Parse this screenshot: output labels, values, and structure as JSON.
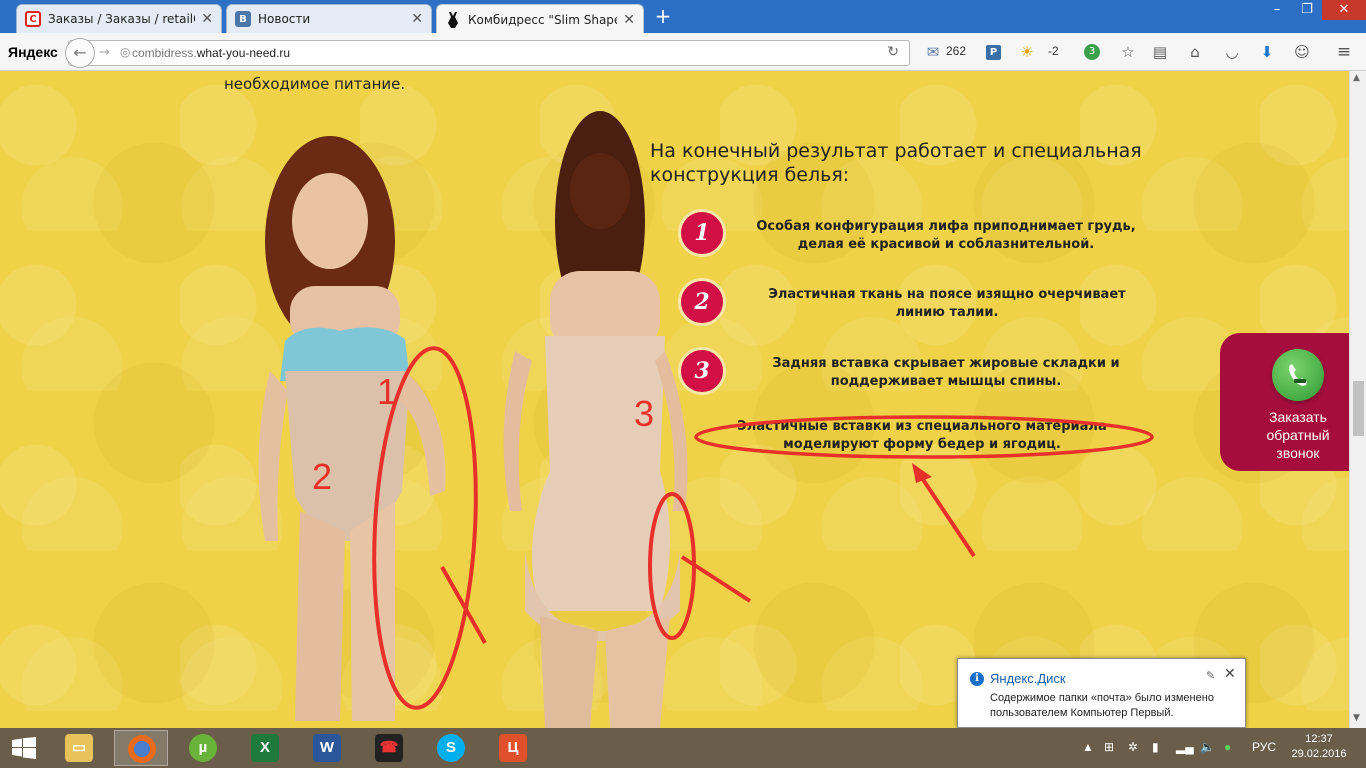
{
  "browser": {
    "tabs": [
      {
        "label": "Заказы / Заказы / retailC",
        "favicon": "retailcrm-icon",
        "active": false
      },
      {
        "label": "Новости",
        "favicon": "vk-icon",
        "active": false
      },
      {
        "label": "Комбидресс \"Slim Shape",
        "favicon": "bodysuit-icon",
        "active": true
      }
    ],
    "logo": "Яндекс",
    "url_prefix": "combidress.",
    "url_domain": "what-you-need.ru",
    "mail_count": "262",
    "weather": "-2",
    "badge_count": "3"
  },
  "page": {
    "top_text": "необходимое питание.",
    "heading": "На конечный результат работает и специальная конструкция белья:",
    "features": [
      {
        "num": "1",
        "text": "Особая конфигурация лифа приподнимает грудь, делая её красивой и соблазнительной."
      },
      {
        "num": "2",
        "text": "Эластичная ткань на поясе изящно очерчивает линию талии."
      },
      {
        "num": "3",
        "text": "Задняя вставка скрывает жировые складки и поддерживает мышцы спины."
      },
      {
        "num": "",
        "text": "Эластичные вставки из специального материала моделируют форму бедер и ягодиц."
      }
    ],
    "annotations": [
      "1",
      "2",
      "3"
    ],
    "callback": "Заказать обратный звонок"
  },
  "notification": {
    "title": "Яндекс.Диск",
    "body": "Содержимое папки «почта» было изменено пользователем Компьютер Первый."
  },
  "taskbar": {
    "apps": [
      "file-explorer-icon",
      "firefox-icon",
      "utorrent-icon",
      "excel-icon",
      "word-icon",
      "phone-app-icon",
      "skype-icon",
      "office-app-icon"
    ],
    "language": "РУС",
    "time": "12:37",
    "date": "29.02.2016"
  },
  "colors": {
    "page_bg": "#efd248",
    "accent": "#d21045",
    "callback_bg": "#a50d3e",
    "annotation": "#e8302a",
    "taskbar": "#6a5d4a"
  }
}
